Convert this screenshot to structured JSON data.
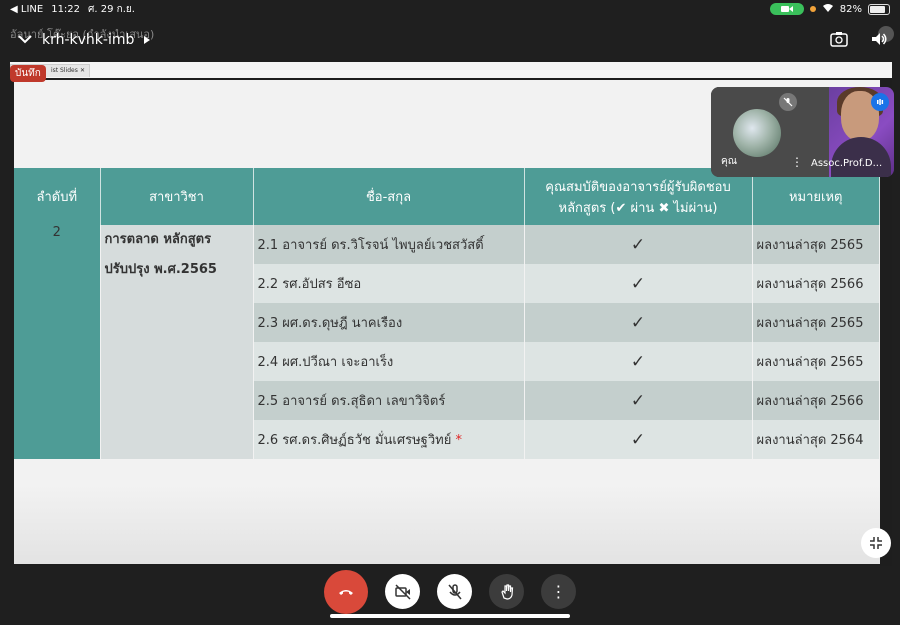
{
  "status": {
    "back_app": "◀ LINE",
    "time": "11:22",
    "date": "ศ. 29 ก.ย.",
    "battery": "82%",
    "battery_level": 0.82
  },
  "meeting": {
    "presenter_text": "อัลนาย์ โต๊ะยอ (กำลังนำเสนอ)",
    "code": "krh-kvhk-imb"
  },
  "record_badge": "บันทึก",
  "browser_tab": "ist Slides",
  "table": {
    "headers": [
      "ลำดับที่",
      "สาขาวิชา",
      "ชื่อ-สกุล",
      "คุณสมบัติของอาจารย์ผู้รับผิดชอบหลักสูตร (✔ ผ่าน ✖ ไม่ผ่าน)",
      "หมายเหตุ"
    ],
    "seq": "2",
    "branch_line1": "การตลาด หลักสูตร",
    "branch_line2": "ปรับปรุง พ.ศ.2565",
    "rows": [
      {
        "name": "2.1 อาจารย์ ดร.วิโรจน์ ไพบูลย์เวชสวัสดิ์",
        "check": "✓",
        "note": "ผลงานล่าสุด 2565"
      },
      {
        "name": "2.2 รศ.อัปสร อีซอ",
        "check": "✓",
        "note": "ผลงานล่าสุด 2566"
      },
      {
        "name": "2.3 ผศ.ดร.ดุษฎี นาคเรือง",
        "check": "✓",
        "note": "ผลงานล่าสุด 2565"
      },
      {
        "name": "2.4 ผศ.ปวีณา เจะอาเร็ง",
        "check": "✓",
        "note": "ผลงานล่าสุด 2565"
      },
      {
        "name": "2.5 อาจารย์ ดร.สุธิดา เลขาวิจิตร์",
        "check": "✓",
        "note": "ผลงานล่าสุด 2566"
      },
      {
        "name": "2.6 รศ.ดร.ศิษฏ์ธวัช มั่นเศรษฐวิทย์",
        "star": "*",
        "check": "✓",
        "note": "ผลงานล่าสุด 2564"
      }
    ]
  },
  "pip": {
    "self_label": "คุณ",
    "other_label": "Assoc.Prof.D..."
  },
  "colors": {
    "teal_header": "#4e9c96",
    "end_call": "#d9493a",
    "record": "#c0392b"
  }
}
